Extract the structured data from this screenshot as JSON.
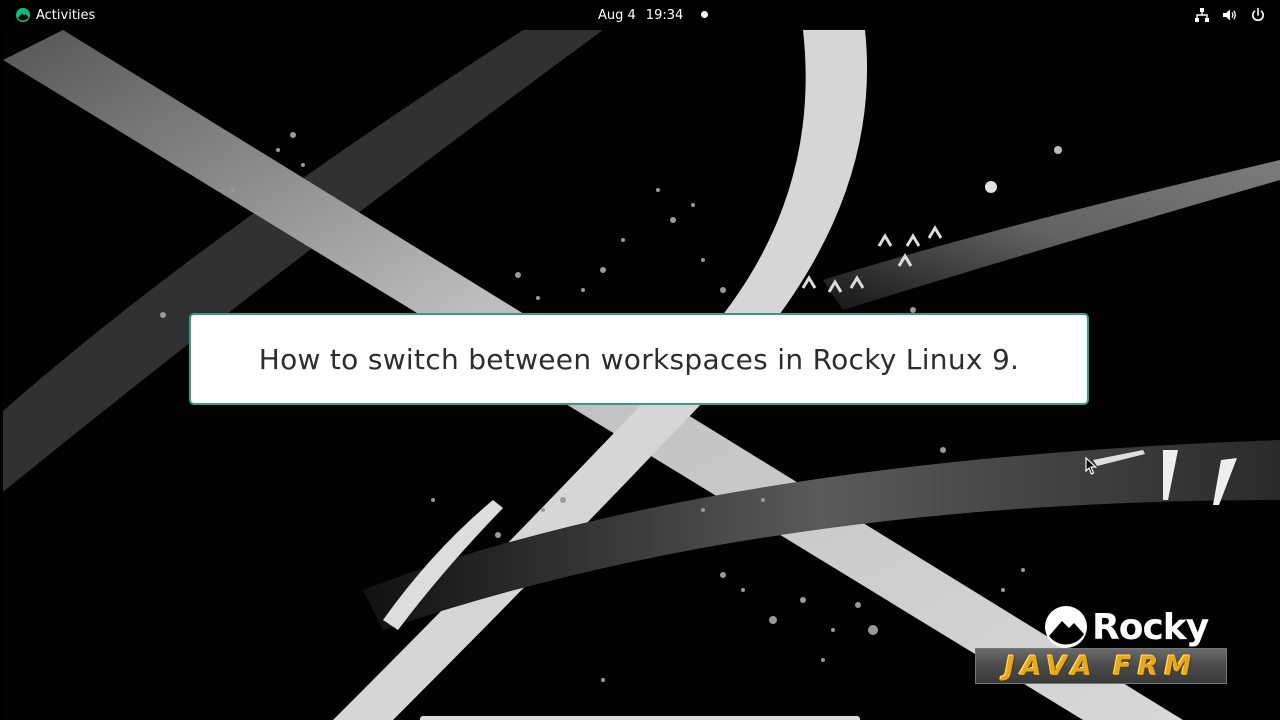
{
  "topbar": {
    "activities_label": "Activities",
    "date": "Aug 4",
    "time": "19:34",
    "tray_icons": [
      "network-icon",
      "volume-icon",
      "power-icon"
    ]
  },
  "caption": {
    "text": "How to switch between workspaces in Rocky Linux 9."
  },
  "watermark": {
    "brand": "Rocky",
    "channel": "JAVA FRM"
  },
  "colors": {
    "topbar_bg": "#000000",
    "caption_border": "#3c9a82",
    "caption_text": "#2d2d2d",
    "channel_text": "#e8a81c",
    "rocky_green": "#10b981"
  }
}
